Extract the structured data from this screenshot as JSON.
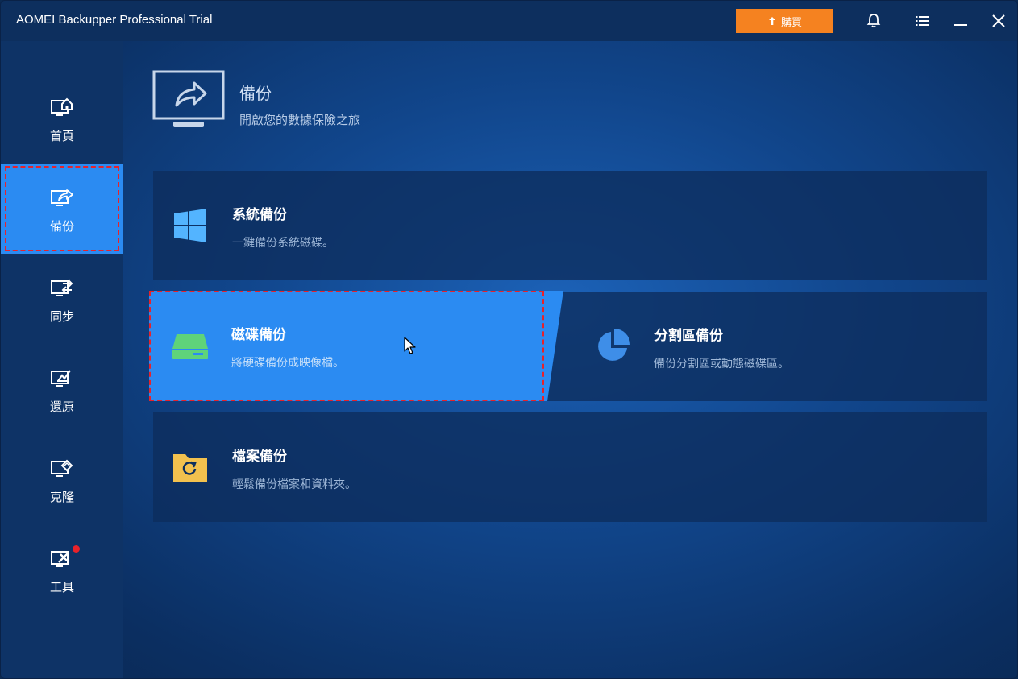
{
  "titlebar": {
    "app_title": "AOMEI Backupper Professional Trial",
    "buy_label": "購買",
    "icons": [
      "arrow-up-icon",
      "bell-icon",
      "menu-icon",
      "minimize-icon",
      "close-icon"
    ]
  },
  "sidebar": {
    "items": [
      {
        "label": "首頁",
        "icon": "home-icon",
        "active": false
      },
      {
        "label": "備份",
        "icon": "backup-icon",
        "active": true
      },
      {
        "label": "同步",
        "icon": "sync-icon",
        "active": false
      },
      {
        "label": "還原",
        "icon": "restore-icon",
        "active": false
      },
      {
        "label": "克隆",
        "icon": "clone-icon",
        "active": false
      },
      {
        "label": "工具",
        "icon": "tools-icon",
        "active": false,
        "badge": true
      }
    ]
  },
  "header": {
    "title": "備份",
    "subtitle": "開啟您的數據保險之旅"
  },
  "cards": {
    "system": {
      "title": "系統備份",
      "desc": "一鍵備份系統磁碟。",
      "icon": "windows-icon"
    },
    "disk": {
      "title": "磁碟備份",
      "desc": "將硬碟備份成映像檔。",
      "icon": "disk-icon"
    },
    "partition": {
      "title": "分割區備份",
      "desc": "備份分割區或動態磁碟區。",
      "icon": "pie-chart-icon"
    },
    "file": {
      "title": "檔案備份",
      "desc": "輕鬆備份檔案和資料夾。",
      "icon": "folder-sync-icon"
    }
  },
  "colors": {
    "accent": "#2b8bf2",
    "buy": "#f58220",
    "highlight_border": "#e8222a",
    "sidebar_bg": "#0e3366"
  }
}
